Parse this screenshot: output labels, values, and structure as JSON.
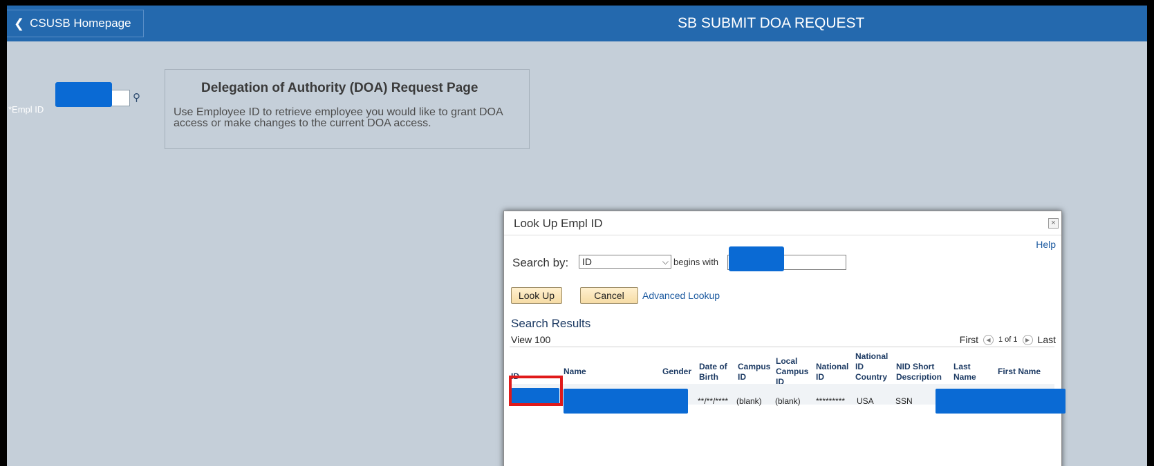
{
  "header": {
    "back_label": "CSUSB Homepage",
    "title": "SB SUBMIT DOA REQUEST"
  },
  "form": {
    "empl_id_label": "*Empl ID"
  },
  "info_box": {
    "title": "Delegation of Authority (DOA) Request Page",
    "text": "Use Employee ID to retrieve employee you would like to grant DOA access or make changes to the current DOA access."
  },
  "modal": {
    "title": "Look Up Empl ID",
    "close_label": "×",
    "help_label": "Help",
    "search_by_label": "Search by:",
    "search_by_value": "ID",
    "begins_with_label": "begins with",
    "lookup_button": "Look Up",
    "cancel_button": "Cancel",
    "advanced_lookup": "Advanced Lookup",
    "results_title": "Search Results",
    "view_label": "View 100",
    "pager": {
      "first": "First",
      "count": "1 of 1",
      "last": "Last"
    },
    "columns": [
      "ID",
      "Name",
      "Gender",
      "Date of Birth",
      "Campus ID",
      "Local Campus ID",
      "National ID",
      "National ID Country",
      "NID Short Description",
      "Last Name",
      "First Name"
    ],
    "row": {
      "dob": "**/**/****",
      "campus_id": "(blank)",
      "local_campus_id": "(blank)",
      "national_id": "*********",
      "country": "USA",
      "nid_short": "SSN"
    }
  },
  "colors": {
    "header_bg": "#2469ae",
    "page_bg": "#c5cfd9",
    "mask": "#0a6ad4",
    "highlight": "#e01a1a"
  }
}
